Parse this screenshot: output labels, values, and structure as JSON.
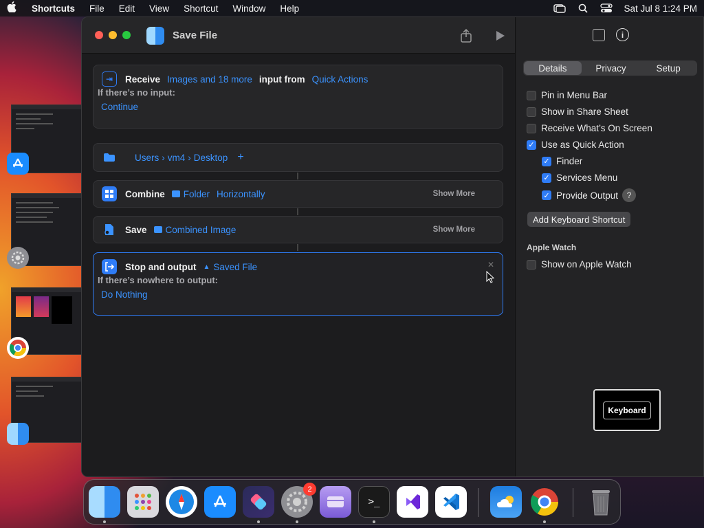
{
  "menubar": {
    "app": "Shortcuts",
    "items": [
      "File",
      "Edit",
      "View",
      "Shortcut",
      "Window",
      "Help"
    ],
    "clock": "Sat Jul 8  1:24 PM"
  },
  "window": {
    "title": "Save File"
  },
  "actions": {
    "receive": {
      "label": "Receive",
      "types": "Images and 18 more",
      "mid": "input from",
      "source": "Quick Actions",
      "no_input_label": "If there’s no input:",
      "no_input_value": "Continue"
    },
    "path": {
      "seg1": "Users",
      "seg2": "vm4",
      "seg3": "Desktop",
      "add": "+"
    },
    "combine": {
      "label": "Combine",
      "var": "Folder",
      "mode": "Horizontally",
      "more": "Show More"
    },
    "save": {
      "label": "Save",
      "var": "Combined Image",
      "more": "Show More"
    },
    "stop": {
      "label": "Stop and output",
      "var": "Saved File",
      "nowhere_label": "If there’s nowhere to output:",
      "nowhere_value": "Do Nothing"
    }
  },
  "sidebar": {
    "tabs": [
      "Details",
      "Privacy",
      "Setup"
    ],
    "options": {
      "pin": "Pin in Menu Bar",
      "share": "Show in Share Sheet",
      "screen": "Receive What’s On Screen",
      "quick": "Use as Quick Action",
      "finder": "Finder",
      "services": "Services Menu",
      "output": "Provide Output"
    },
    "add_shortcut": "Add Keyboard Shortcut",
    "watch_section": "Apple Watch",
    "watch_option": "Show on Apple Watch",
    "tooltip": "Keyboard"
  },
  "dock": {
    "settings_badge": "2"
  }
}
